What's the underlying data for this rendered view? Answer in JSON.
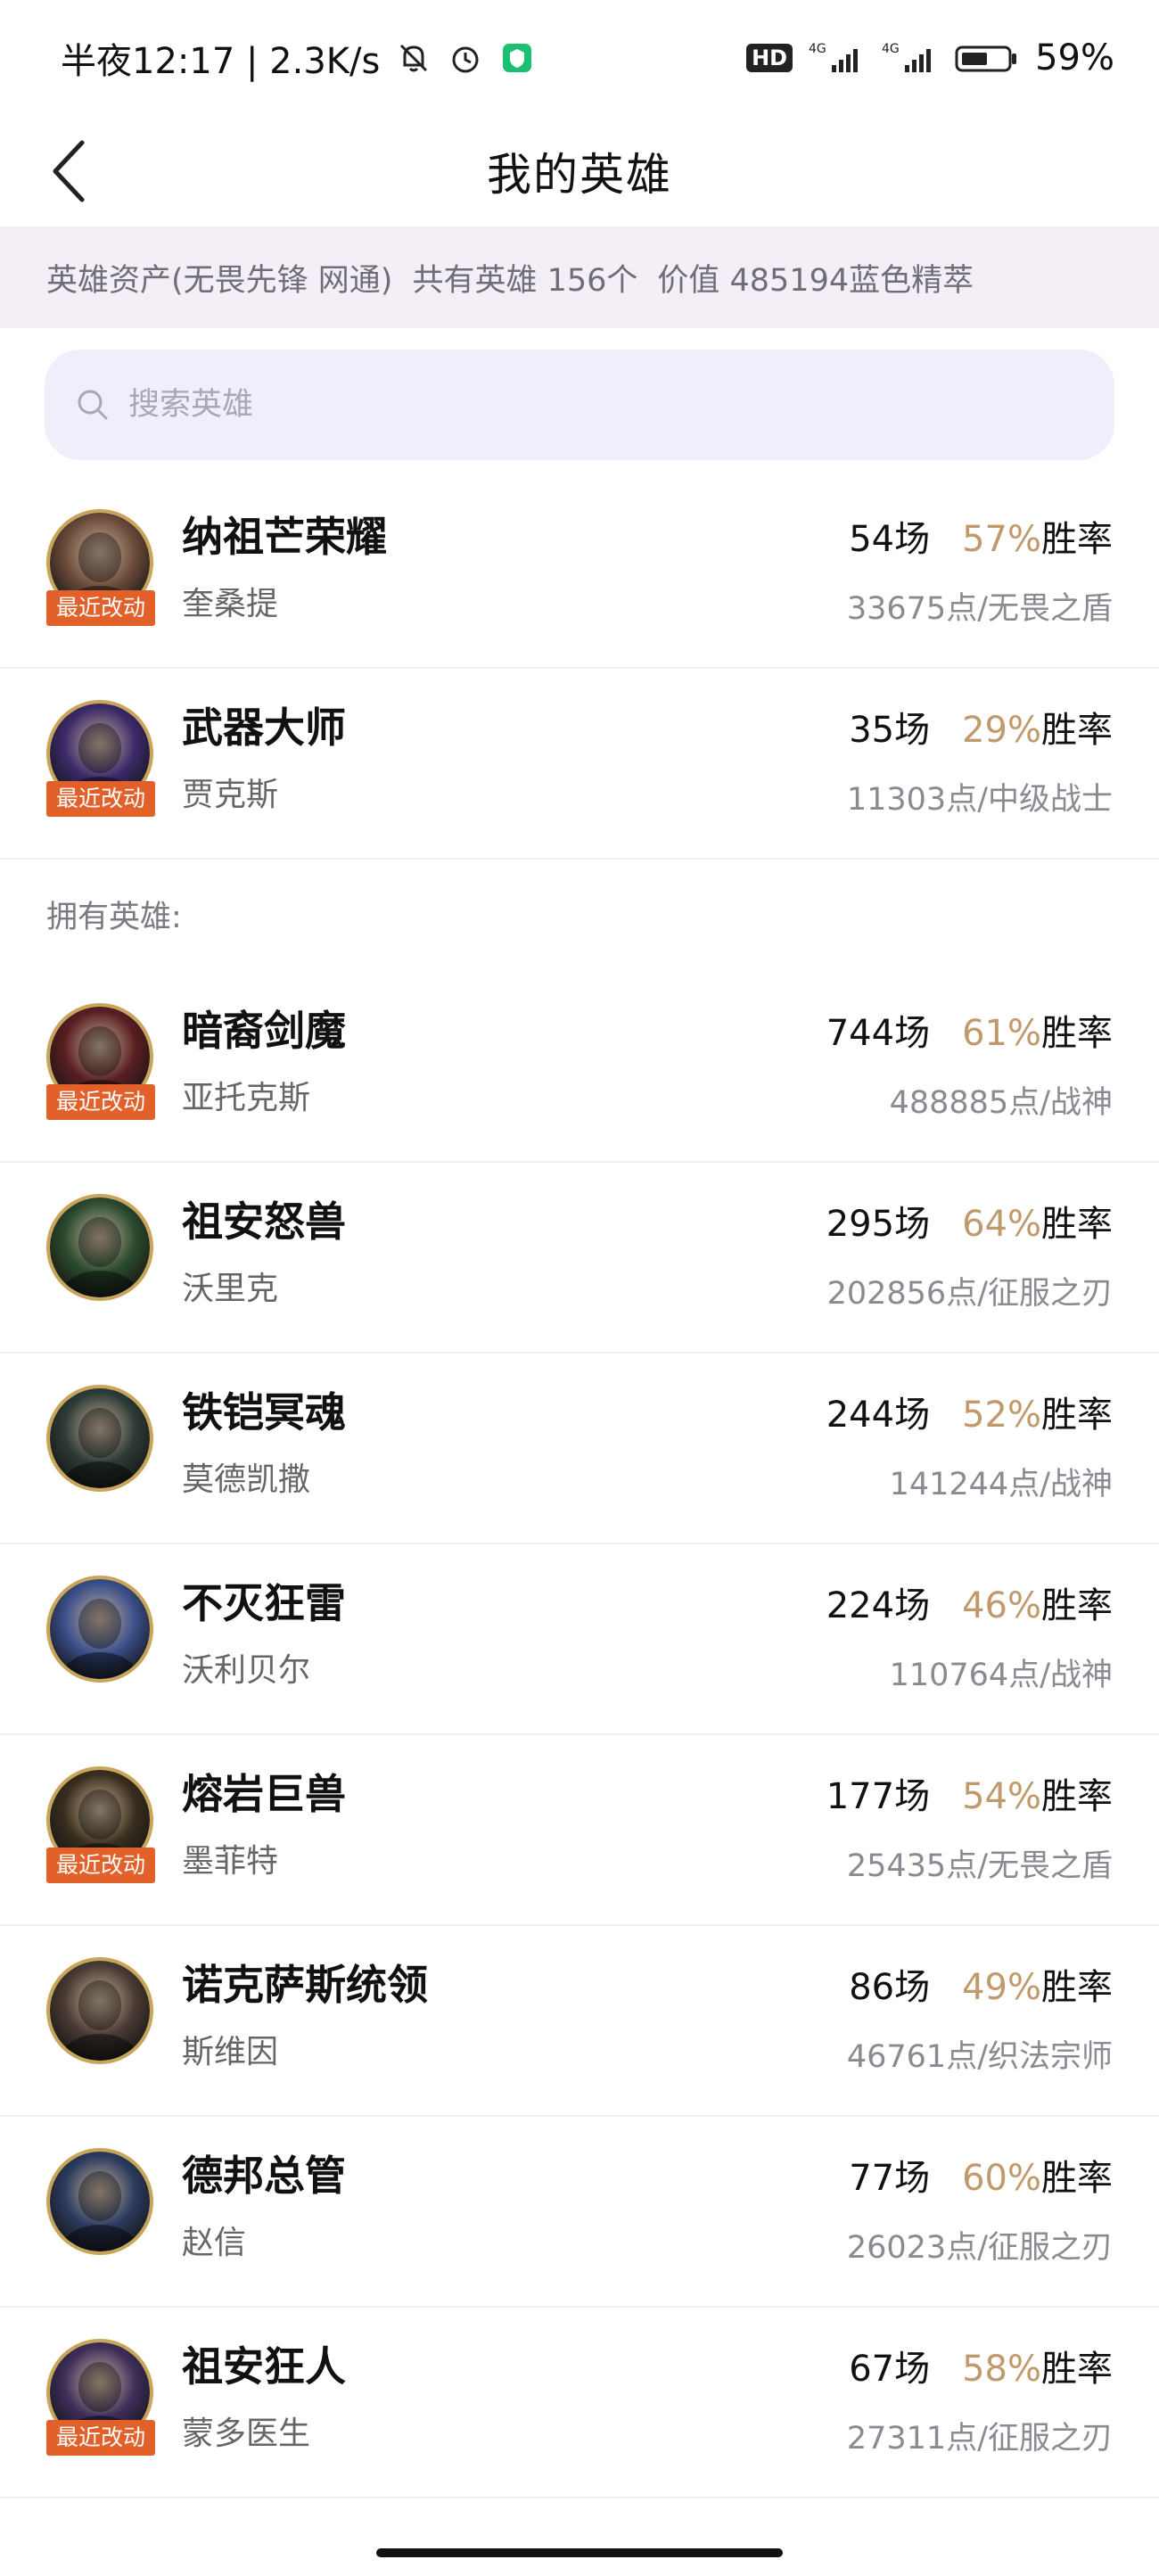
{
  "status_bar": {
    "time_text": "半夜12:17 | 2.3K/s",
    "hd_badge": "HD",
    "network_1": "4G",
    "network_2": "4G",
    "battery": "59%"
  },
  "nav": {
    "title": "我的英雄"
  },
  "asset_summary": {
    "label": "英雄资产(无畏先锋 网通)",
    "count": "共有英雄 156个",
    "value": "价值 485194蓝色精萃"
  },
  "search": {
    "placeholder": "搜索英雄"
  },
  "owned_label": "拥有英雄:",
  "recent_badge": "最近改动",
  "rate_suffix": "胜率",
  "top_heroes": [
    {
      "name": "纳祖芒荣耀",
      "champion": "奎桑提",
      "games": "54场",
      "winrate": "57%",
      "points": "33675点/无畏之盾",
      "recent": true,
      "avatar_color": "#6b4a3a"
    },
    {
      "name": "武器大师",
      "champion": "贾克斯",
      "games": "35场",
      "winrate": "29%",
      "points": "11303点/中级战士",
      "recent": true,
      "avatar_color": "#3b2a6a"
    }
  ],
  "owned_heroes": [
    {
      "name": "暗裔剑魔",
      "champion": "亚托克斯",
      "games": "744场",
      "winrate": "61%",
      "points": "488885点/战神",
      "recent": true,
      "avatar_color": "#5a1e22"
    },
    {
      "name": "祖安怒兽",
      "champion": "沃里克",
      "games": "295场",
      "winrate": "64%",
      "points": "202856点/征服之刃",
      "recent": false,
      "avatar_color": "#2a4a2e"
    },
    {
      "name": "铁铠冥魂",
      "champion": "莫德凯撒",
      "games": "244场",
      "winrate": "52%",
      "points": "141244点/战神",
      "recent": false,
      "avatar_color": "#2d3b36"
    },
    {
      "name": "不灭狂雷",
      "champion": "沃利贝尔",
      "games": "224场",
      "winrate": "46%",
      "points": "110764点/战神",
      "recent": false,
      "avatar_color": "#3a4f8a"
    },
    {
      "name": "熔岩巨兽",
      "champion": "墨菲特",
      "games": "177场",
      "winrate": "54%",
      "points": "25435点/无畏之盾",
      "recent": true,
      "avatar_color": "#3a2e1e"
    },
    {
      "name": "诺克萨斯统领",
      "champion": "斯维因",
      "games": "86场",
      "winrate": "49%",
      "points": "46761点/织法宗师",
      "recent": false,
      "avatar_color": "#4a3a34"
    },
    {
      "name": "德邦总管",
      "champion": "赵信",
      "games": "77场",
      "winrate": "60%",
      "points": "26023点/征服之刃",
      "recent": false,
      "avatar_color": "#2c3b5e"
    },
    {
      "name": "祖安狂人",
      "champion": "蒙多医生",
      "games": "67场",
      "winrate": "58%",
      "points": "27311点/征服之刃",
      "recent": true,
      "avatar_color": "#3e2e5a"
    }
  ]
}
